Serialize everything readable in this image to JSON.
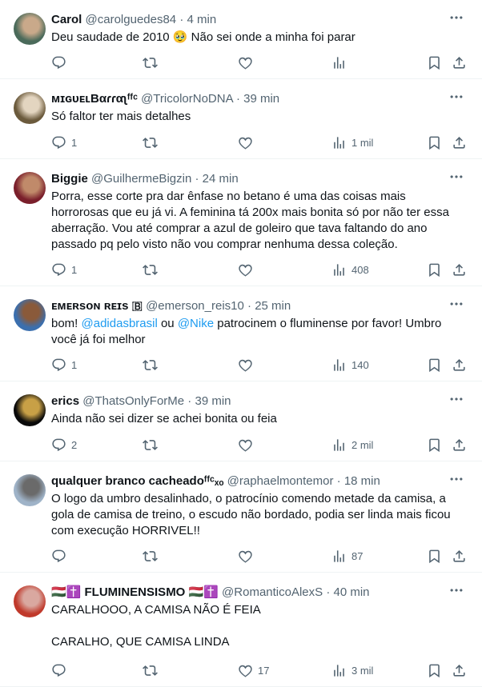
{
  "tweets": [
    {
      "name": "Carol",
      "handle": "@carolguedes84",
      "time": "4 min",
      "parts": [
        {
          "t": "Deu saudade de 2010 "
        },
        {
          "t": "🥹"
        },
        {
          "t": " Não sei onde a minha foi parar"
        }
      ],
      "replies": "",
      "retweets": "",
      "likes": "",
      "views": "",
      "avatar_colors": [
        "#4a6a5a",
        "#c9a98a"
      ]
    },
    {
      "name": "ᴍɪɢᴜᴇʟBαɾɾαʅᶠᶠᶜ",
      "handle": "@TricolorNoDNA",
      "time": "39 min",
      "parts": [
        {
          "t": "Só faltor ter mais detalhes"
        }
      ],
      "replies": "1",
      "retweets": "",
      "likes": "",
      "views": "1 mil",
      "avatar_colors": [
        "#6b5a3c",
        "#e3d5c0"
      ]
    },
    {
      "name": "Biggie",
      "handle": "@GuilhermeBigzin",
      "time": "24 min",
      "parts": [
        {
          "t": "Porra, esse corte pra dar ênfase no betano é uma das coisas mais horrorosas que eu já vi. A feminina tá 200x mais bonita só por não ter essa aberração. Vou até comprar a azul de goleiro que tava faltando do ano passado pq pelo visto não vou comprar nenhuma dessa coleção."
        }
      ],
      "replies": "1",
      "retweets": "",
      "likes": "",
      "views": "408",
      "avatar_colors": [
        "#7a1f2b",
        "#c08a6a"
      ]
    },
    {
      "name": "ᴇᴍᴇʀsᴏɴ ʀᴇɪs 🇧",
      "handle": "@emerson_reis10",
      "time": "25 min",
      "parts": [
        {
          "t": "bom! "
        },
        {
          "t": "@adidasbrasil",
          "mention": true
        },
        {
          "t": " ou "
        },
        {
          "t": "@Nike",
          "mention": true
        },
        {
          "t": " patrocinem o fluminense por favor! Umbro você já foi melhor"
        }
      ],
      "replies": "1",
      "retweets": "",
      "likes": "",
      "views": "140",
      "avatar_colors": [
        "#3b6fae",
        "#8a5a3a"
      ]
    },
    {
      "name": "erics",
      "handle": "@ThatsOnlyForMe",
      "time": "39 min",
      "parts": [
        {
          "t": "Ainda não sei dizer se achei bonita ou feia"
        }
      ],
      "replies": "2",
      "retweets": "",
      "likes": "",
      "views": "2 mil",
      "avatar_colors": [
        "#0a0a0a",
        "#c8a046"
      ]
    },
    {
      "name": "qualquer branco cacheadoᶠᶠᶜₓₒ",
      "handle": "@raphaelmontemor",
      "time": "18 min",
      "parts": [
        {
          "t": "O logo da umbro desalinhado, o patrocínio comendo metade da camisa, a gola de camisa de treino, o escudo não bordado, podia ser linda mais ficou com execução HORRIVEL!!"
        }
      ],
      "replies": "",
      "retweets": "",
      "likes": "",
      "views": "87",
      "avatar_colors": [
        "#9fb3c8",
        "#6a6a6a"
      ]
    },
    {
      "name": "🇭🇺✝️ FLUMINENSISMO 🇭🇺✝️",
      "handle": "@RomanticoAlexS",
      "time": "40 min",
      "parts": [
        {
          "t": "CARALHOOO, A CAMISA NÃO É FEIA\n\nCARALHO, QUE CAMISA LINDA"
        }
      ],
      "replies": "",
      "retweets": "",
      "likes": "17",
      "views": "3 mil",
      "avatar_colors": [
        "#c0392b",
        "#d9a8a0"
      ]
    }
  ],
  "heights": null,
  "icons": {
    "reply": "reply-icon",
    "retweet": "retweet-icon",
    "like": "heart-icon",
    "views": "views-icon",
    "bookmark": "bookmark-icon",
    "share": "share-icon",
    "more": "more-icon"
  },
  "colors": {
    "text": "#0f1419",
    "secondary": "#536471",
    "link": "#1d9bf0",
    "divider": "#eff3f4"
  }
}
